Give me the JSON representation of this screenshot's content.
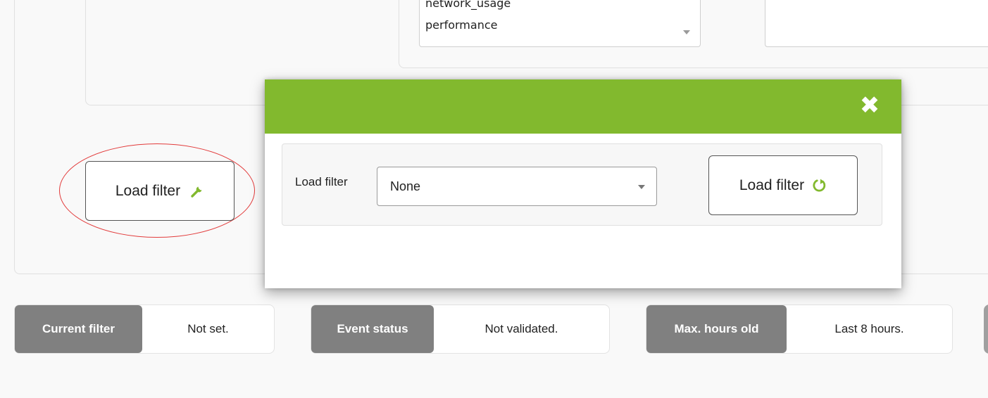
{
  "filter_form": {
    "module_group_options_visible": [
      "network_usage",
      "performance"
    ]
  },
  "load_filter_button": {
    "label": "Load filter",
    "icon": "wrench-icon"
  },
  "status_strip": [
    {
      "label": "Current filter",
      "value": "Not set."
    },
    {
      "label": "Event status",
      "value": "Not validated."
    },
    {
      "label": "Max. hours old",
      "value": "Last 8 hours."
    }
  ],
  "modal": {
    "header_color": "#82b92e",
    "close_icon": "close-icon",
    "field_label": "Load filter",
    "select_value": "None",
    "button_label": "Load filter",
    "button_icon": "refresh-icon"
  },
  "colors": {
    "accent_green": "#82b92e",
    "highlight_red": "#e23b3b",
    "status_label_bg": "#808080"
  }
}
